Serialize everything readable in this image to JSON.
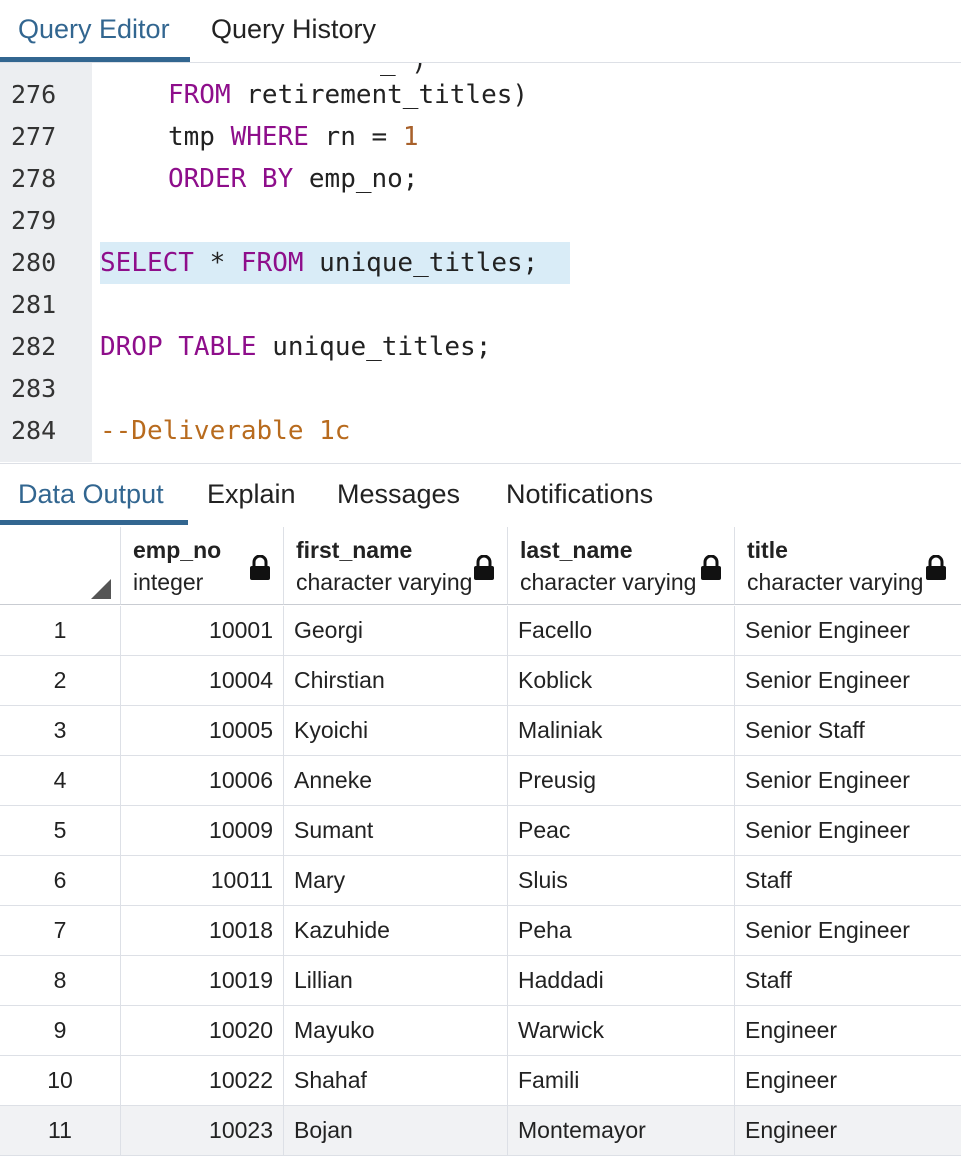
{
  "tabs": {
    "query_editor": "Query Editor",
    "query_history": "Query History"
  },
  "editor": {
    "line_numbers": [
      "276",
      "277",
      "278",
      "279",
      "280",
      "281",
      "282",
      "283",
      "284"
    ],
    "partial_top": "_            )",
    "lines": {
      "l276_kw": "FROM",
      "l276_rest": " retirement_titles)",
      "l277_a": "tmp ",
      "l277_kw": "WHERE",
      "l277_b": " rn = ",
      "l277_num": "1",
      "l278_kw": "ORDER BY",
      "l278_rest": " emp_no;",
      "l280_kw1": "SELECT",
      "l280_mid": " * ",
      "l280_kw2": "FROM",
      "l280_rest": " unique_titles;",
      "l282_kw": "DROP TABLE",
      "l282_rest": " unique_titles;",
      "l284_cmt": "--Deliverable 1c"
    }
  },
  "output_tabs": {
    "data_output": "Data Output",
    "explain": "Explain",
    "messages": "Messages",
    "notifications": "Notifications"
  },
  "grid": {
    "columns": [
      {
        "name": "emp_no",
        "type": "integer"
      },
      {
        "name": "first_name",
        "type": "character varying"
      },
      {
        "name": "last_name",
        "type": "character varying"
      },
      {
        "name": "title",
        "type": "character varying"
      }
    ],
    "rows": [
      {
        "idx": "1",
        "emp_no": "10001",
        "first_name": "Georgi",
        "last_name": "Facello",
        "title": "Senior Engineer"
      },
      {
        "idx": "2",
        "emp_no": "10004",
        "first_name": "Chirstian",
        "last_name": "Koblick",
        "title": "Senior Engineer"
      },
      {
        "idx": "3",
        "emp_no": "10005",
        "first_name": "Kyoichi",
        "last_name": "Maliniak",
        "title": "Senior Staff"
      },
      {
        "idx": "4",
        "emp_no": "10006",
        "first_name": "Anneke",
        "last_name": "Preusig",
        "title": "Senior Engineer"
      },
      {
        "idx": "5",
        "emp_no": "10009",
        "first_name": "Sumant",
        "last_name": "Peac",
        "title": "Senior Engineer"
      },
      {
        "idx": "6",
        "emp_no": "10011",
        "first_name": "Mary",
        "last_name": "Sluis",
        "title": "Staff"
      },
      {
        "idx": "7",
        "emp_no": "10018",
        "first_name": "Kazuhide",
        "last_name": "Peha",
        "title": "Senior Engineer"
      },
      {
        "idx": "8",
        "emp_no": "10019",
        "first_name": "Lillian",
        "last_name": "Haddadi",
        "title": "Staff"
      },
      {
        "idx": "9",
        "emp_no": "10020",
        "first_name": "Mayuko",
        "last_name": "Warwick",
        "title": "Engineer"
      },
      {
        "idx": "10",
        "emp_no": "10022",
        "first_name": "Shahaf",
        "last_name": "Famili",
        "title": "Engineer"
      },
      {
        "idx": "11",
        "emp_no": "10023",
        "first_name": "Bojan",
        "last_name": "Montemayor",
        "title": "Engineer"
      }
    ]
  },
  "colors": {
    "accent": "#326690",
    "keyword": "#8e0e8b",
    "number": "#a8612b",
    "comment": "#b86b1e",
    "highlight": "#d9ecf7"
  },
  "icons": {
    "lock": "lock-icon",
    "sort_corner": "corner-triangle-icon"
  }
}
